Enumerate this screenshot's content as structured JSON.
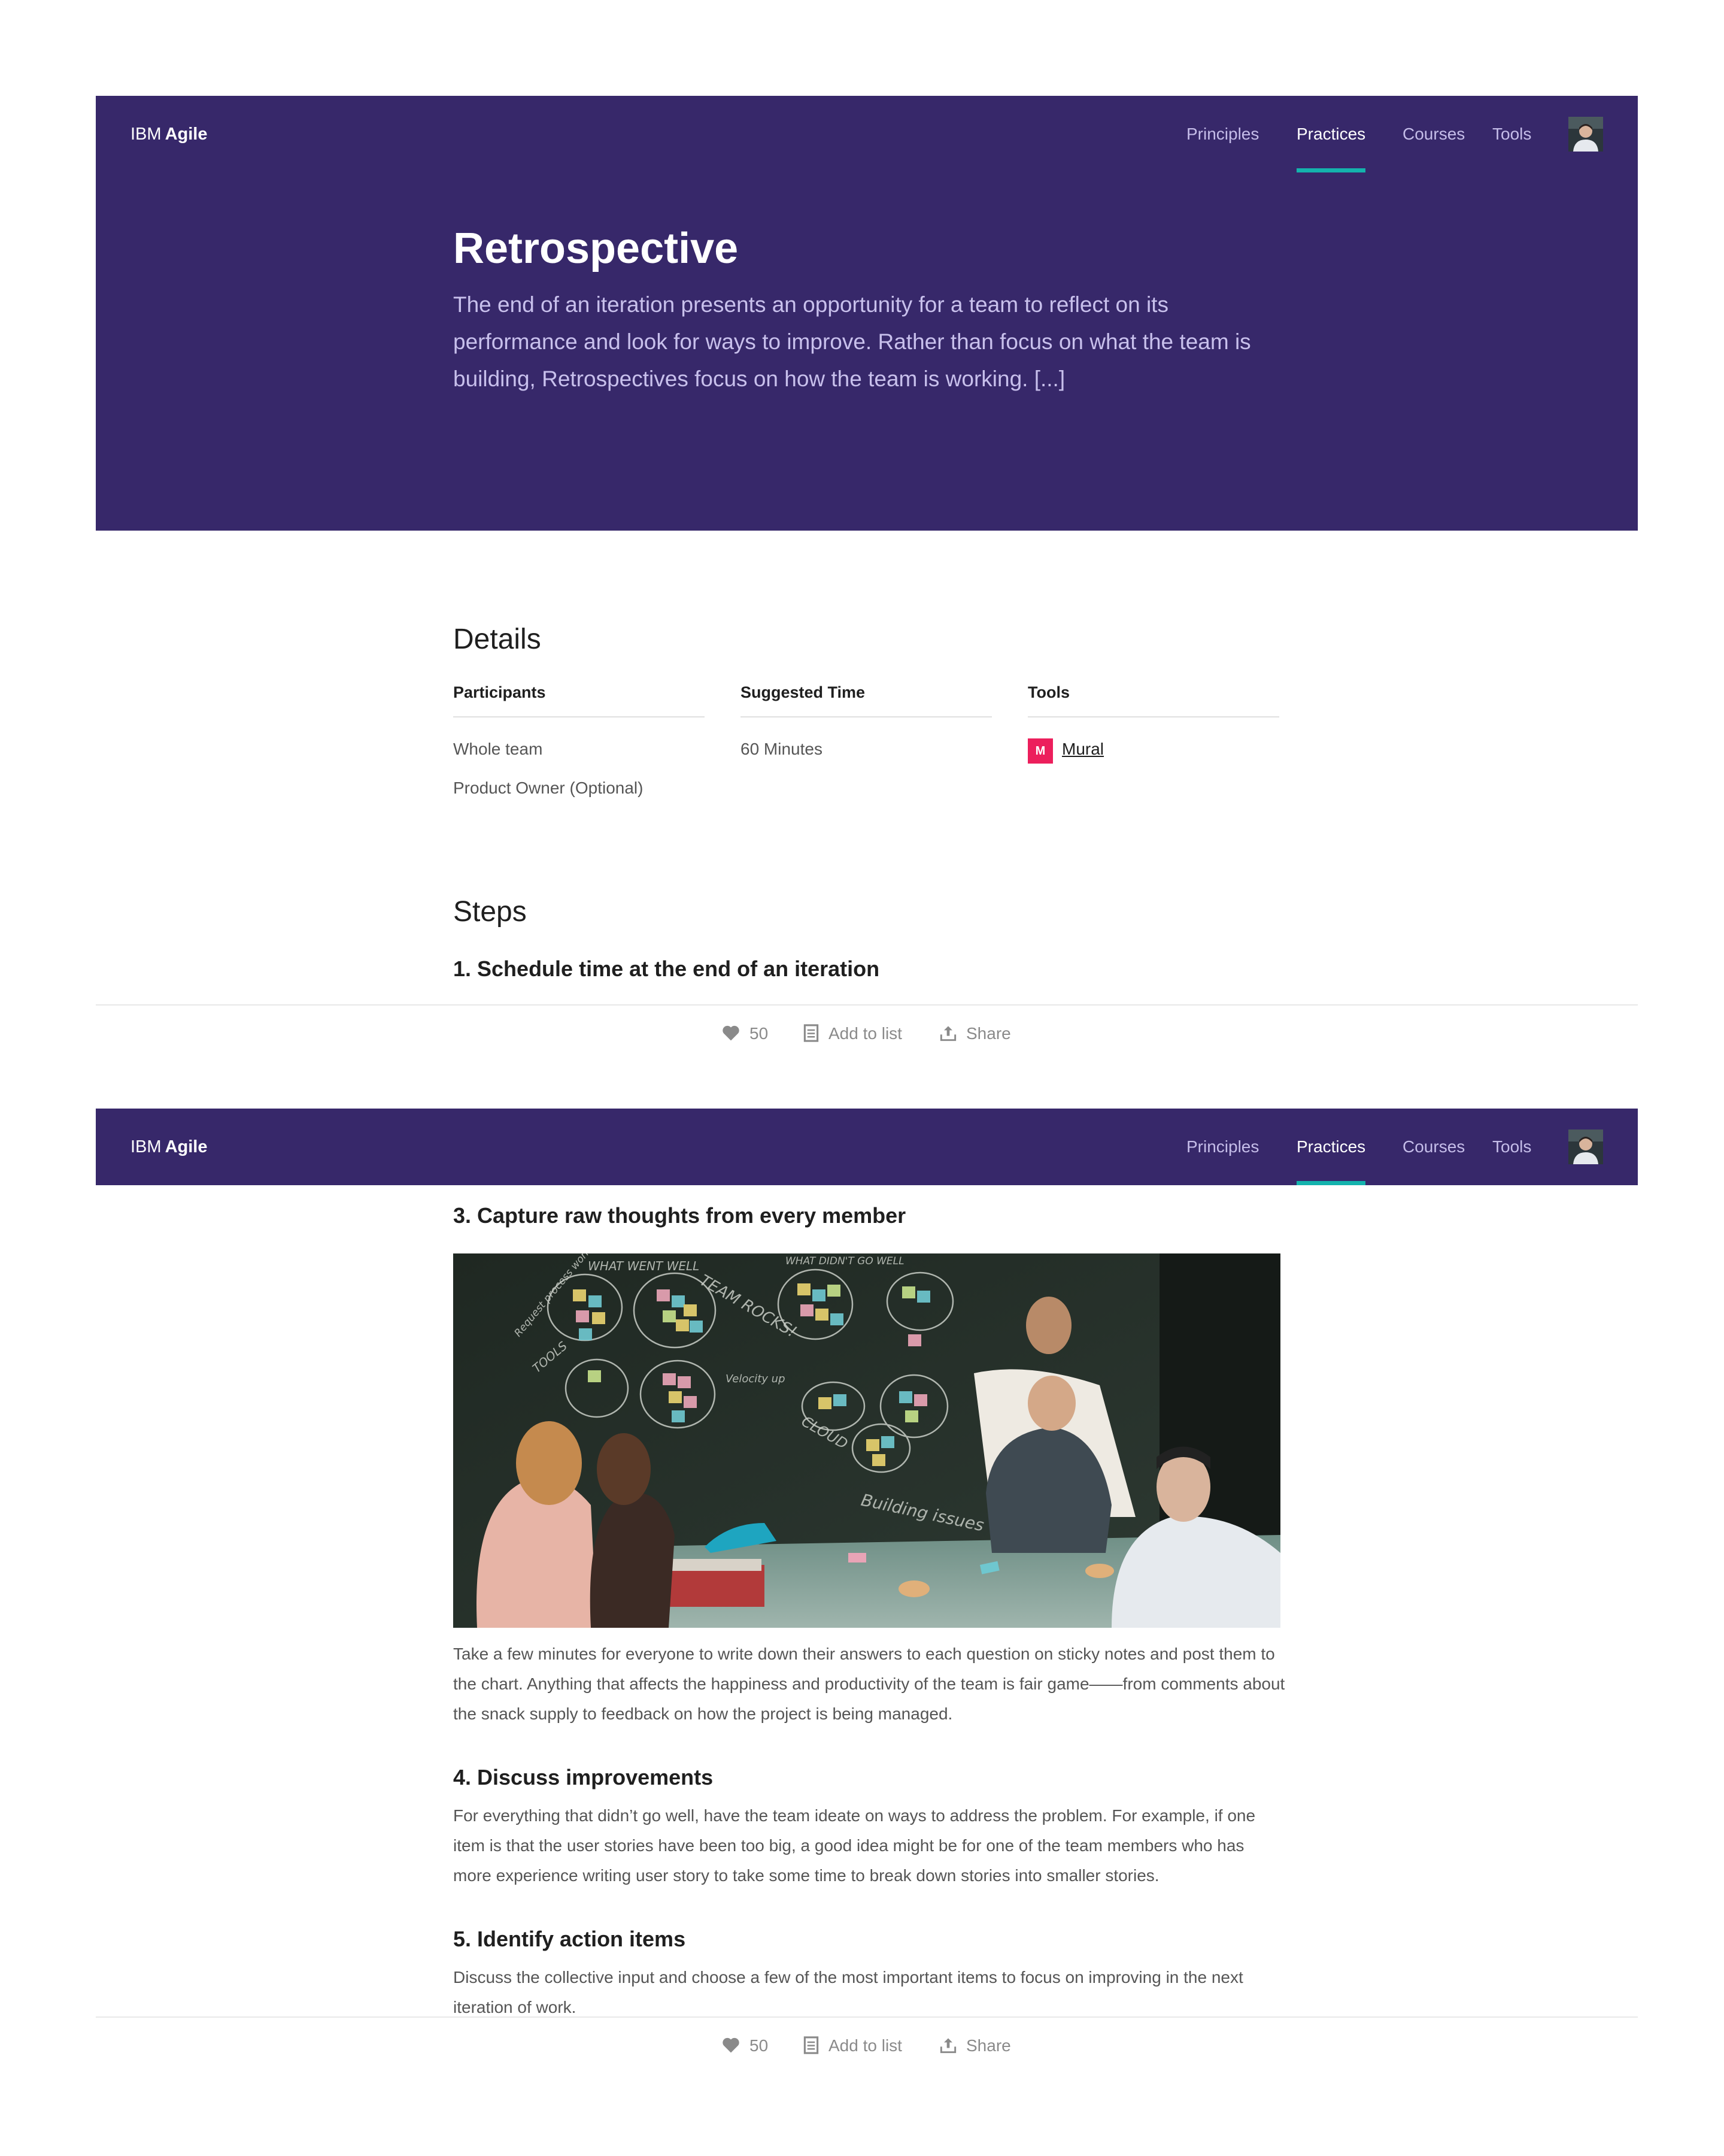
{
  "nav": {
    "brand_ibm": "IBM",
    "brand_agile": "Agile",
    "links": [
      {
        "label": "Principles"
      },
      {
        "label": "Practices"
      },
      {
        "label": "Courses"
      },
      {
        "label": "Tools"
      }
    ],
    "active": "Practices"
  },
  "hero": {
    "title": "Retrospective",
    "description": "The end of an iteration presents an opportunity for a team to reflect on its performance and look for ways to improve. Rather than focus on what the team is building, Retrospectives focus on how the team is working. [...]"
  },
  "details": {
    "heading": "Details",
    "participants": {
      "label": "Participants",
      "values": [
        "Whole team",
        "Product Owner (Optional)"
      ]
    },
    "time": {
      "label": "Suggested Time",
      "value": "60 Minutes"
    },
    "tools": {
      "label": "Tools",
      "icon_letter": "M",
      "link": "Mural"
    }
  },
  "steps": {
    "heading": "Steps",
    "step1": "1. Schedule time at the end of an iteration",
    "step3": "3. Capture raw thoughts from every member",
    "step3_text": "Take a few minutes for everyone to write down their answers to each question on sticky notes and post them to the chart. Anything that affects the happiness and productivity of the team is fair game——from comments about the snack supply to feedback on how the project is being managed.",
    "step4": "4. Discuss improvements",
    "step4_text": "For everything that didn’t go well, have the team ideate on ways to address the problem. For example, if one item is that the user stories have been too big, a good idea might be for one of the team members who has more experience writing user story to take some time to break down stories into smaller stories.",
    "step5": "5. Identify action items",
    "step5_text": "Discuss the collective input and choose a few of the most important items to focus on improving in the next iteration of work."
  },
  "photo": {
    "chalk": [
      "WHAT WENT WELL",
      "WHAT DIDN'T GO WELL",
      "TEAM ROCKS!",
      "Velocity up",
      "CLOUD",
      "Building issues",
      "TOOLS",
      "Request process working"
    ]
  },
  "actions": {
    "likes": "50",
    "add_to_list": "Add to list",
    "share": "Share"
  },
  "colors": {
    "brand_purple": "#37286a",
    "accent_teal": "#14b3ad",
    "mural_pink": "#ec1f5c"
  }
}
